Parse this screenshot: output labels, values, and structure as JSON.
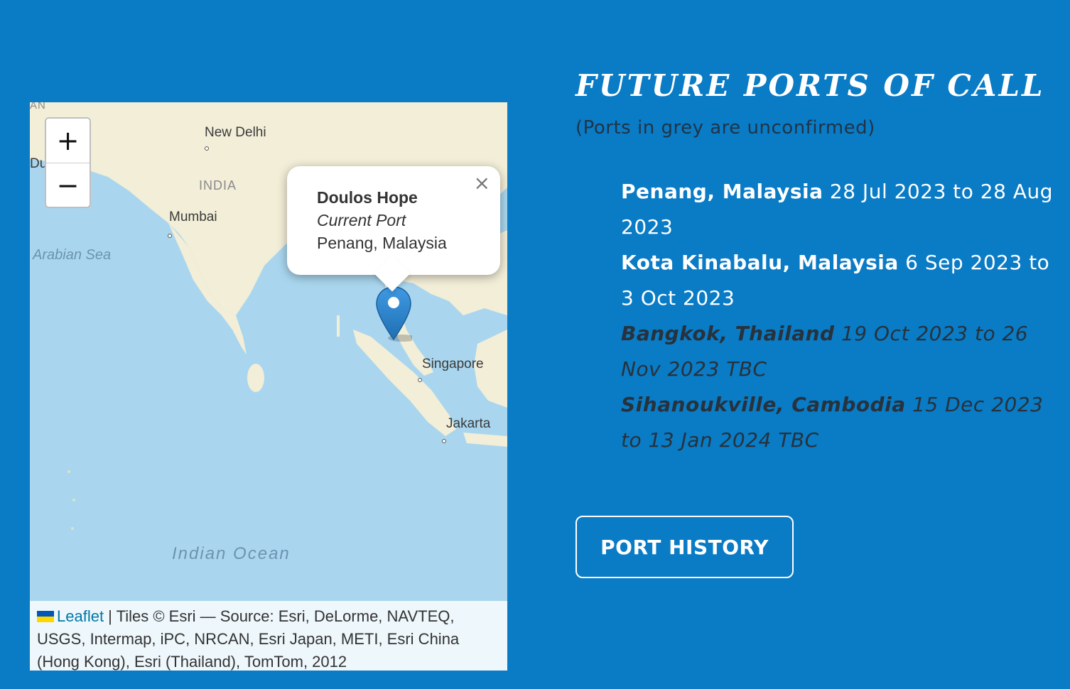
{
  "map": {
    "zoom_in_label": "+",
    "zoom_out_label": "−",
    "labels": {
      "new_delhi": "New Delhi",
      "india": "INDIA",
      "mumbai": "Mumbai",
      "arabian_sea": "Arabian Sea",
      "singapore": "Singapore",
      "jakarta": "Jakarta",
      "indian_ocean": "Indian Ocean",
      "edge_top": "AN",
      "edge_left": "Du"
    },
    "popup": {
      "title": "Doulos Hope",
      "subtitle": "Current Port",
      "location": "Penang, Malaysia",
      "close_label": "×"
    },
    "attribution": {
      "leaflet_link": "Leaflet",
      "text": " | Tiles © Esri — Source: Esri, DeLorme, NAVTEQ, USGS, Intermap, iPC, NRCAN, Esri Japan, METI, Esri China (Hong Kong), Esri (Thailand), TomTom, 2012"
    },
    "colors": {
      "water": "#a9d6ee",
      "land": "#f2eed8",
      "marker": "#2a81cb"
    }
  },
  "section": {
    "heading": "FUTURE PORTS OF CALL",
    "note": "(Ports in grey are unconfirmed)"
  },
  "ports": [
    {
      "place": "Penang, Malaysia",
      "dates": "28 Jul 2023 to 28 Aug 2023",
      "confirmed": true
    },
    {
      "place": "Kota Kinabalu, Malaysia",
      "dates": "6 Sep 2023 to 3 Oct 2023",
      "confirmed": true
    },
    {
      "place": "Bangkok, Thailand",
      "dates": "19 Oct 2023 to 26 Nov 2023 TBC",
      "confirmed": false
    },
    {
      "place": "Sihanoukville, Cambodia",
      "dates": "15 Dec 2023 to 13 Jan 2024 TBC",
      "confirmed": false
    }
  ],
  "buttons": {
    "port_history": "PORT HISTORY"
  },
  "colors": {
    "background": "#0a7bc5",
    "unconfirmed_text": "#27323c"
  }
}
